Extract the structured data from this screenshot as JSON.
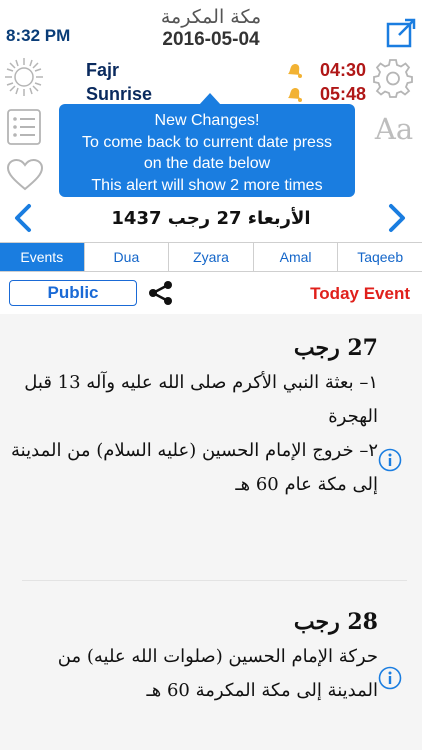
{
  "header": {
    "city": "مكة المكرمة",
    "date": "2016-05-04",
    "clock": "8:32 PM",
    "hijri_date": "الأربعاء 27 رجب 1437"
  },
  "prayers": [
    {
      "name": "Fajr",
      "time": "04:30"
    },
    {
      "name": "Sunrise",
      "time": "05:48"
    }
  ],
  "alert": {
    "lines": [
      "New Changes!",
      "To come back to current date press",
      "on the date below",
      "This alert will show 2 more times"
    ]
  },
  "font_button": "Aa",
  "tabs": [
    {
      "label": "Events",
      "active": true
    },
    {
      "label": "Dua",
      "active": false
    },
    {
      "label": "Zyara",
      "active": false
    },
    {
      "label": "Amal",
      "active": false
    },
    {
      "label": "Taqeeb",
      "active": false
    }
  ],
  "toolbar": {
    "public_label": "Public",
    "today_event_label": "Today Event"
  },
  "events": [
    {
      "date": "27 رجب",
      "lines": [
        "١– بعثة النبي الأكرم صلى الله عليه وآله 13 قبل الهجرة",
        "٢– خروج الإمام الحسين (عليه السلام) من المدينة إلى مكة عام 60 هـ"
      ]
    },
    {
      "date": "28 رجب",
      "lines": [
        "حركة الإمام الحسين (صلوات الله عليه) من المدينة إلى مكة المكرمة 60 هـ"
      ]
    }
  ],
  "colors": {
    "accent": "#1a7de0",
    "prayer_time": "#b01717",
    "today_event": "#e0201b",
    "clock": "#0a3d78"
  },
  "icons": {
    "external": "external-link-icon",
    "sun": "sun-icon",
    "list": "list-icon",
    "heart": "heart-icon",
    "gear": "gear-icon",
    "bell": "bell-icon",
    "share": "share-icon",
    "info": "info-icon",
    "prev": "chevron-left-icon",
    "next": "chevron-right-icon"
  }
}
